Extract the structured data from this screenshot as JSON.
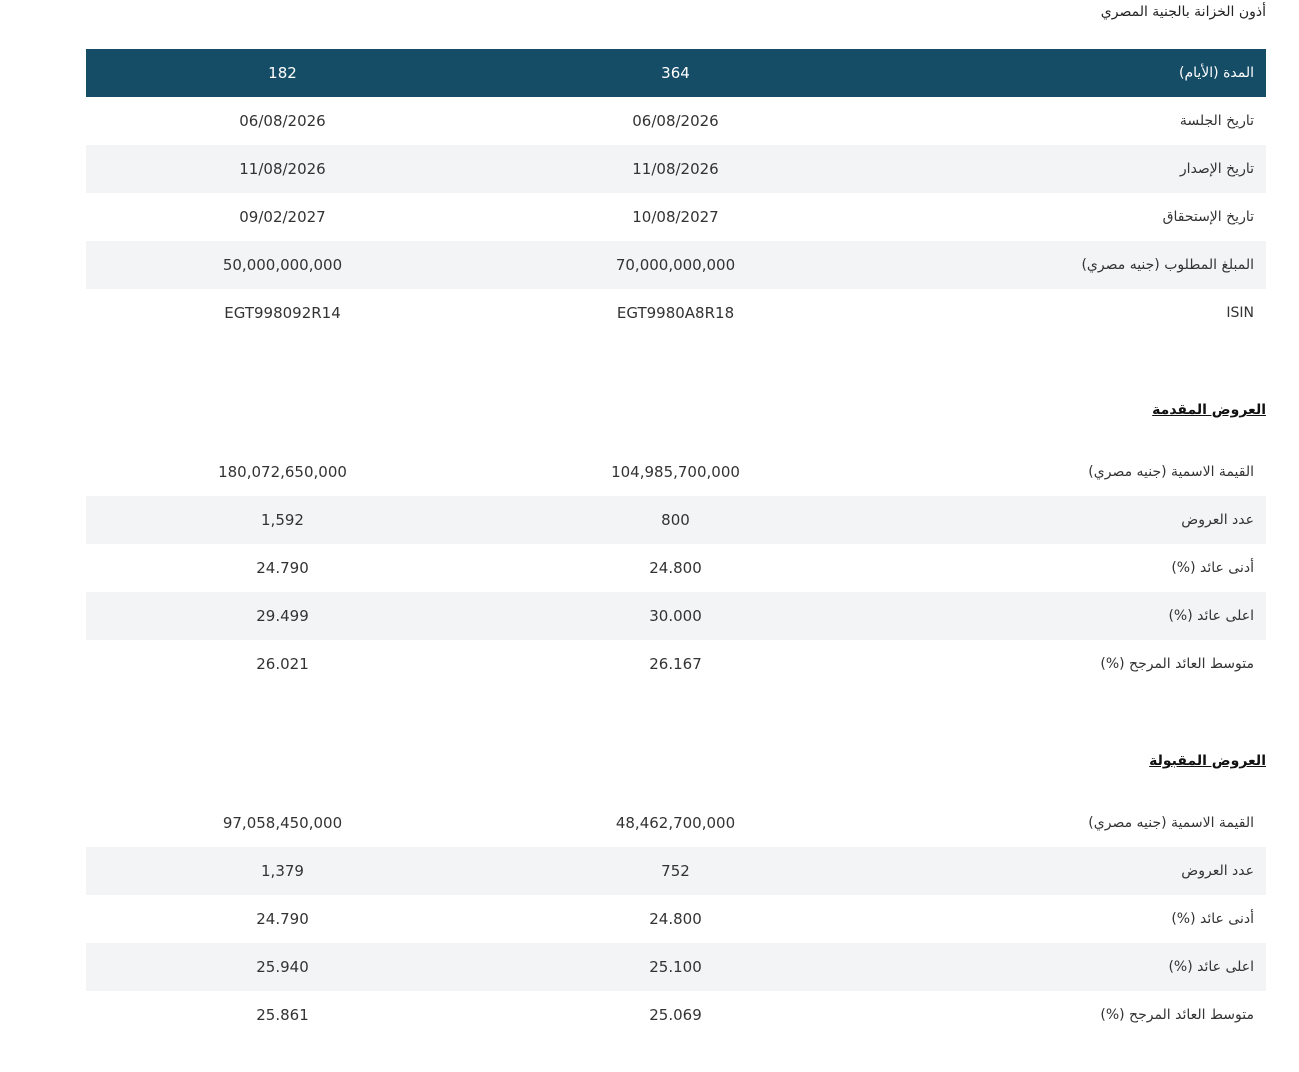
{
  "page_title": "أذون الخزانة بالجنية المصري",
  "main_table": {
    "header": {
      "label": "المدة (الأيام)",
      "col_b": "364",
      "col_a": "182"
    },
    "rows": [
      {
        "label": "تاريخ الجلسة",
        "col_b": "06/08/2026",
        "col_a": "06/08/2026"
      },
      {
        "label": "تاريخ الإصدار",
        "col_b": "11/08/2026",
        "col_a": "11/08/2026"
      },
      {
        "label": "تاريخ الإستحقاق",
        "col_b": "10/08/2027",
        "col_a": "09/02/2027"
      },
      {
        "label": "المبلغ المطلوب (جنيه مصري)",
        "col_b": "70,000,000,000",
        "col_a": "50,000,000,000"
      },
      {
        "label": "ISIN",
        "col_b": "EGT9980A8R18",
        "col_a": "EGT998092R14"
      }
    ]
  },
  "bids_submitted": {
    "title": "العروض المقدمة",
    "rows": [
      {
        "label": "القيمة الاسمية (جنيه مصري)",
        "col_b": "104,985,700,000",
        "col_a": "180,072,650,000"
      },
      {
        "label": "عدد العروض",
        "col_b": "800",
        "col_a": "1,592"
      },
      {
        "label": "أدنى عائد (%)",
        "col_b": "24.800",
        "col_a": "24.790"
      },
      {
        "label": "اعلى عائد (%)",
        "col_b": "30.000",
        "col_a": "29.499"
      },
      {
        "label": "متوسط العائد المرجح (%)",
        "col_b": "26.167",
        "col_a": "26.021"
      }
    ]
  },
  "bids_accepted": {
    "title": "العروض المقبولة",
    "rows": [
      {
        "label": "القيمة الاسمية (جنيه مصري)",
        "col_b": "48,462,700,000",
        "col_a": "97,058,450,000"
      },
      {
        "label": "عدد العروض",
        "col_b": "752",
        "col_a": "1,379"
      },
      {
        "label": "أدنى عائد (%)",
        "col_b": "24.800",
        "col_a": "24.790"
      },
      {
        "label": "اعلى عائد (%)",
        "col_b": "25.100",
        "col_a": "25.940"
      },
      {
        "label": "متوسط العائد المرجح (%)",
        "col_b": "25.069",
        "col_a": "25.861"
      }
    ]
  },
  "colors": {
    "header_bg": "#154c66",
    "alt_row_bg": "#f3f4f6",
    "text": "#333333"
  }
}
